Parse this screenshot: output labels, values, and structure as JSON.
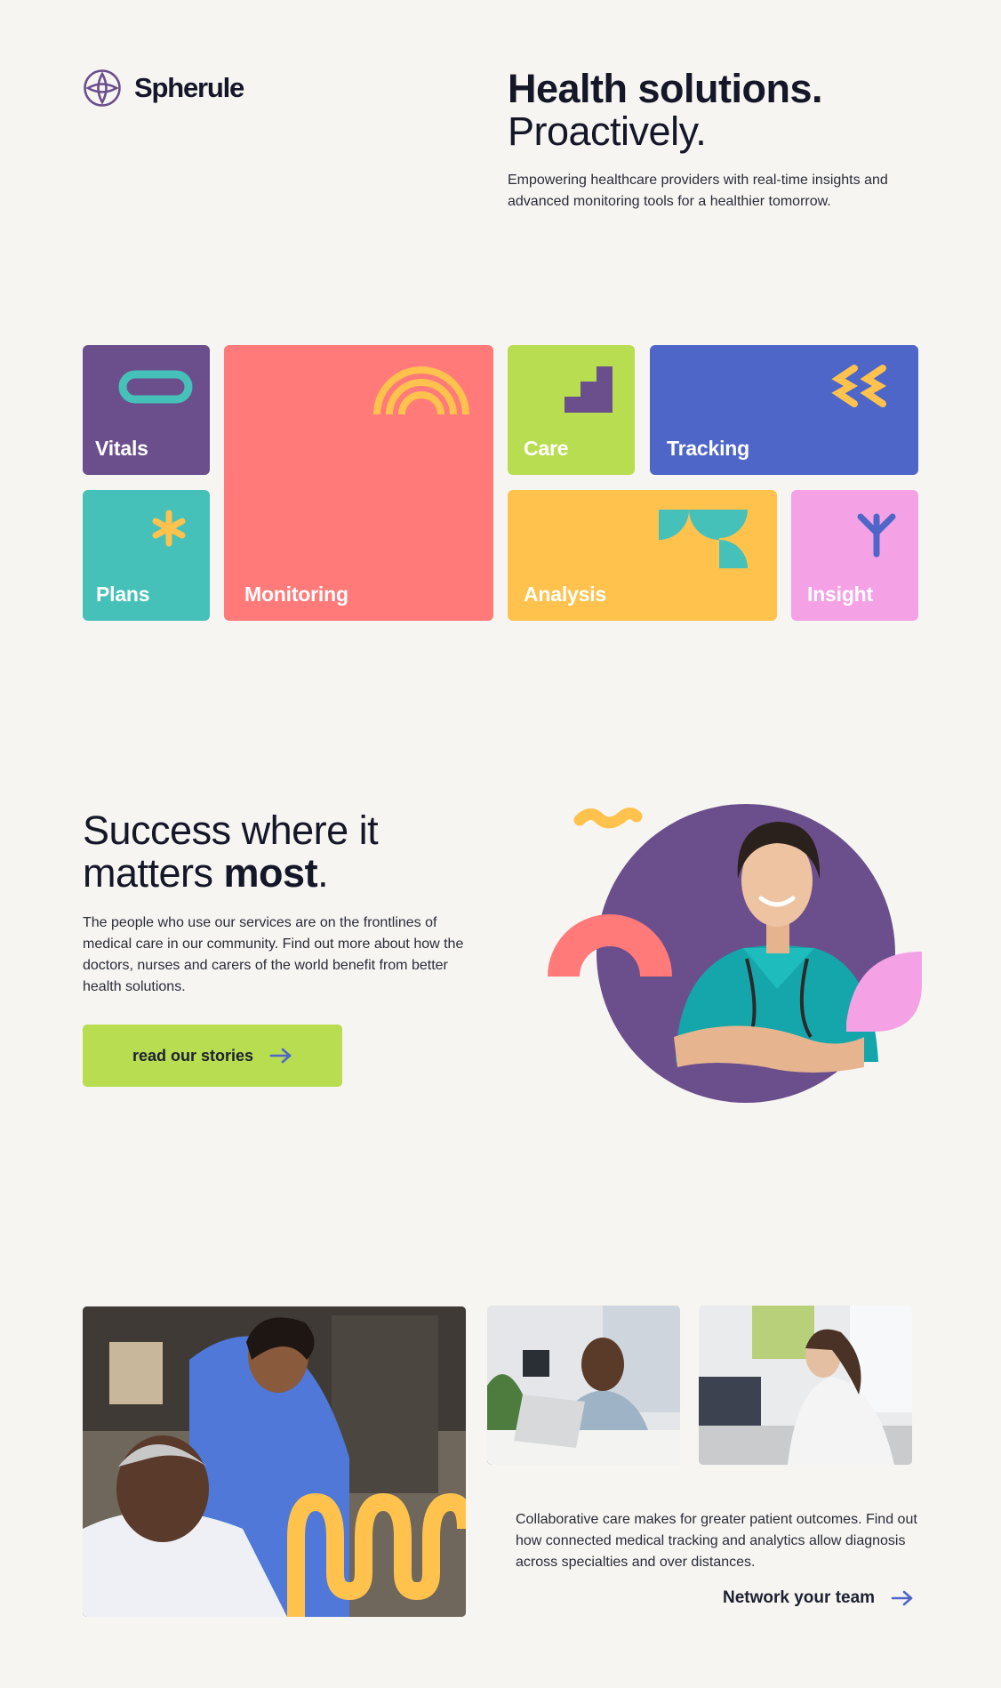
{
  "brand": {
    "name": "Spherule",
    "logo_icon": "sphere-logo-icon"
  },
  "hero": {
    "title_bold": "Health solutions.",
    "title_regular": "Proactively.",
    "subtitle": "Empowering healthcare providers with real-time insights and advanced monitoring tools for a healthier tomorrow."
  },
  "tiles": [
    {
      "label": "Vitals",
      "color": "#6b4f8c",
      "icon": "pill-icon"
    },
    {
      "label": "Monitoring",
      "color": "#ff7a78",
      "icon": "signal-arcs-icon"
    },
    {
      "label": "Care",
      "color": "#b8dd50",
      "icon": "stairs-icon"
    },
    {
      "label": "Tracking",
      "color": "#4f66c9",
      "icon": "squiggle-icon"
    },
    {
      "label": "Plans",
      "color": "#46c1b9",
      "icon": "asterisk-icon"
    },
    {
      "label": "Analysis",
      "color": "#ffc24d",
      "icon": "leaf-shapes-icon"
    },
    {
      "label": "Insight",
      "color": "#f4a1e6",
      "icon": "y-branch-icon"
    }
  ],
  "success": {
    "title_regular": "Success where it matters ",
    "title_bold": "most",
    "title_end": ".",
    "body": "The people who use our services are on the frontlines of medical care in our community. Find out more about how the doctors, nurses and carers of the world benefit from better health solutions.",
    "cta_label": "read our stories"
  },
  "collaborate": {
    "body": "Collaborative care makes for greater patient outcomes. Find out how connected medical tracking and analytics allow diagnosis across specialties and over distances.",
    "link_label": "Network your team"
  },
  "colors": {
    "background": "#f6f5f2",
    "purple": "#6b4f8c",
    "coral": "#ff7a78",
    "lime": "#b8dd50",
    "blue": "#4f66c9",
    "teal": "#46c1b9",
    "yellow": "#ffc24d",
    "pink": "#f4a1e6"
  }
}
